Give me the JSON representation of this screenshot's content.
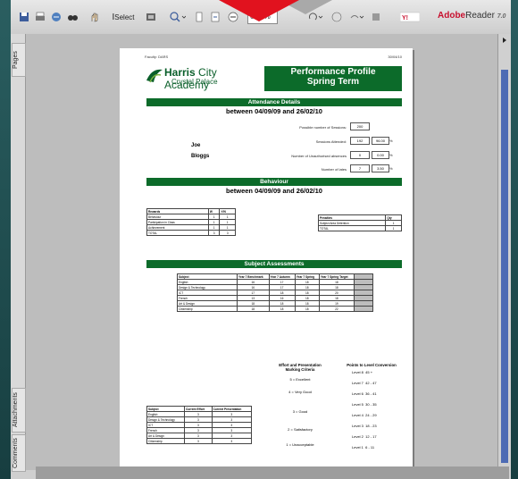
{
  "app": {
    "toolbar": {
      "select_label": "Select",
      "zoom_value": "68.6%",
      "brand": "Adobe",
      "brand_product": "Reader",
      "brand_version": "7.0"
    },
    "sidebar_tabs": [
      "Pages",
      "Attachments",
      "Comments"
    ]
  },
  "doc": {
    "header_left": "Faculty: DARS",
    "header_right": "30/04/10",
    "logo_main": "Harris",
    "logo_second": "City Academy",
    "logo_sub": "Crystal Palace",
    "banner_line1": "Performance Profile",
    "banner_line2": "Spring Term",
    "attendance": {
      "title": "Attendance Details",
      "period": "between 04/09/09 and 26/02/10",
      "student_first": "Joe",
      "student_last": "Bloggs",
      "rows": [
        {
          "label": "Possible number of Sessions:",
          "value": "200",
          "pct": ""
        },
        {
          "label": "Sessions Attended:",
          "value": "192",
          "pct": "96.00"
        },
        {
          "label": "Number of Unauthorised absences",
          "value": "0",
          "pct": "0.00"
        },
        {
          "label": "Number of lates",
          "value": "7",
          "pct": "3.50"
        }
      ],
      "pct_symbol": "%"
    },
    "behaviour": {
      "title": "Behaviour",
      "period": "between 04/09/09 and 26/02/10",
      "rewards": {
        "headers": [
          "Rewards",
          "W",
          "Y/N"
        ],
        "rows": [
          [
            "Behaviour",
            "1",
            "1"
          ],
          [
            "Participation in Class",
            "1",
            "1"
          ],
          [
            "Achievement",
            "1",
            "1"
          ],
          [
            "TOTAL",
            "3",
            "3"
          ]
        ]
      },
      "penalties": {
        "headers": [
          "Penalties",
          "Qty"
        ],
        "rows": [
          [
            "Subject Area Detention",
            "1"
          ],
          [
            "TOTAL",
            "1"
          ]
        ]
      }
    },
    "assessments": {
      "title": "Subject Assessments",
      "headers": [
        "Subject",
        "Year 7 Benchmark",
        "Year 7 Autumn",
        "Year 7 Spring",
        "Year 7 Spring Target"
      ],
      "rows": [
        [
          "English",
          "16",
          "17",
          "18",
          "18"
        ],
        [
          "Design & Technology",
          "16",
          "17",
          "18",
          "18"
        ],
        [
          "ICT",
          "17",
          "18",
          "18",
          "20"
        ],
        [
          "French",
          "13",
          "16",
          "18",
          "18"
        ],
        [
          "Art & Design",
          "18",
          "18",
          "18",
          "19"
        ],
        [
          "Citizenship",
          "18",
          "18",
          "18",
          "22"
        ]
      ]
    },
    "effort": {
      "headers": [
        "Subject",
        "Current Effort",
        "Current Presentation"
      ],
      "rows": [
        [
          "English",
          "3",
          "3"
        ],
        [
          "Design & Technology",
          "3",
          "3"
        ],
        [
          "ICT",
          "3",
          "3"
        ],
        [
          "French",
          "3",
          "3"
        ],
        [
          "Art & Design",
          "3",
          "3"
        ],
        [
          "Citizenship",
          "3",
          "3"
        ]
      ]
    },
    "criteria": {
      "title_line1": "Effort and Presentation",
      "title_line2": "Marking Criteria",
      "items": [
        "5 = Excellent",
        "4 = Very Good",
        "3 = Good",
        "2 = Satisfactory",
        "1 = Unacceptable"
      ]
    },
    "levels": {
      "title": "Points to Level Conversion",
      "items": [
        {
          "level": "Level 8",
          "range": "45 +"
        },
        {
          "level": "Level 7",
          "range": "42 - 47"
        },
        {
          "level": "Level 6",
          "range": "36 - 41"
        },
        {
          "level": "Level 5",
          "range": "30 - 35"
        },
        {
          "level": "Level 4",
          "range": "24 - 29"
        },
        {
          "level": "Level 3",
          "range": "18 - 23"
        },
        {
          "level": "Level 2",
          "range": "12 - 17"
        },
        {
          "level": "Level 1",
          "range": "6 - 11"
        }
      ]
    }
  },
  "colors": {
    "academy_green": "#0c6b2a",
    "brand_red": "#c8102e",
    "notch_red": "#e1121e"
  }
}
